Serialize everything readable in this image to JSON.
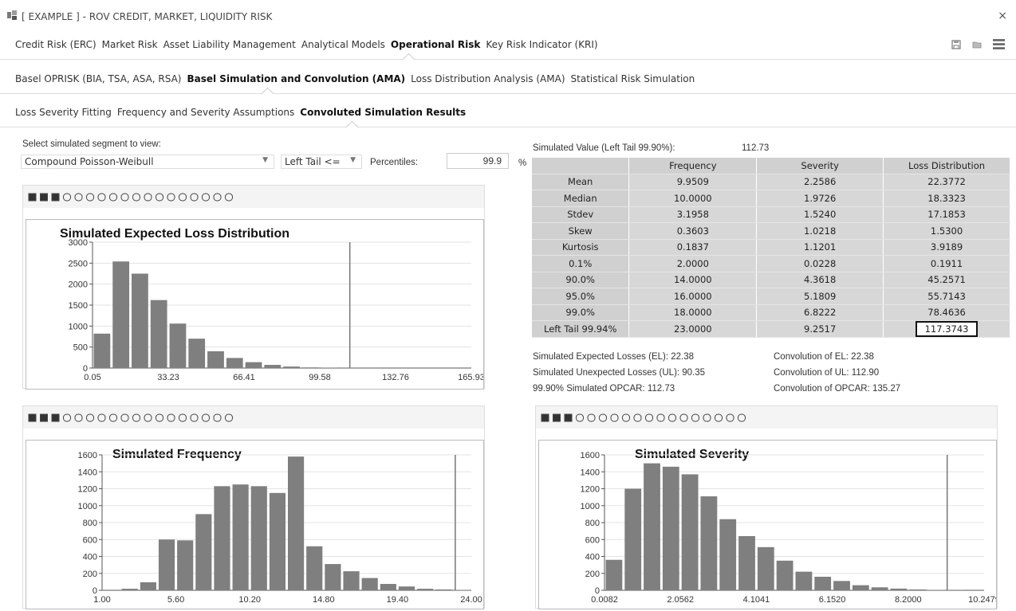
{
  "window": {
    "title": "[ EXAMPLE ] - ROV CREDIT, MARKET, LIQUIDITY RISK",
    "close": "×"
  },
  "main_tabs": [
    {
      "label": "Credit Risk (ERC)",
      "active": false
    },
    {
      "label": "Market Risk",
      "active": false
    },
    {
      "label": "Asset Liability Management",
      "active": false
    },
    {
      "label": "Analytical Models",
      "active": false
    },
    {
      "label": "Operational Risk",
      "active": true
    },
    {
      "label": "Key Risk Indicator (KRI)",
      "active": false
    }
  ],
  "sub_tabs": [
    {
      "label": "Basel OPRISK (BIA, TSA, ASA, RSA)",
      "active": false
    },
    {
      "label": "Basel Simulation and Convolution (AMA)",
      "active": true
    },
    {
      "label": "Loss Distribution Analysis (AMA)",
      "active": false
    },
    {
      "label": "Statistical Risk Simulation",
      "active": false
    }
  ],
  "sub_sub_tabs": [
    {
      "label": "Loss Severity Fitting",
      "active": false
    },
    {
      "label": "Frequency and Severity Assumptions",
      "active": false
    },
    {
      "label": "Convoluted Simulation Results",
      "active": true
    }
  ],
  "controls": {
    "segment_label": "Select simulated segment to view:",
    "segment_value": "Compound Poisson-Weibull",
    "tail_value": "Left Tail <=",
    "percentiles_label": "Percentiles:",
    "percentiles_value": "99.9",
    "percent_sign": "%"
  },
  "results": {
    "sim_value_label": "Simulated Value (Left Tail 99.90%):",
    "sim_value": "112.73",
    "columns": [
      "",
      "Frequency",
      "Severity",
      "Loss Distribution"
    ],
    "rows": [
      {
        "label": "Mean",
        "freq": "9.9509",
        "sev": "2.2586",
        "loss": "22.3772"
      },
      {
        "label": "Median",
        "freq": "10.0000",
        "sev": "1.9726",
        "loss": "18.3323"
      },
      {
        "label": "Stdev",
        "freq": "3.1958",
        "sev": "1.5240",
        "loss": "17.1853"
      },
      {
        "label": "Skew",
        "freq": "0.3603",
        "sev": "1.0218",
        "loss": "1.5300"
      },
      {
        "label": "Kurtosis",
        "freq": "0.1837",
        "sev": "1.1201",
        "loss": "3.9189"
      },
      {
        "label": "0.1%",
        "freq": "2.0000",
        "sev": "0.0228",
        "loss": "0.1911"
      },
      {
        "label": "90.0%",
        "freq": "14.0000",
        "sev": "4.3618",
        "loss": "45.2571"
      },
      {
        "label": "95.0%",
        "freq": "16.0000",
        "sev": "5.1809",
        "loss": "55.7143"
      },
      {
        "label": "99.0%",
        "freq": "18.0000",
        "sev": "6.8222",
        "loss": "78.4636"
      },
      {
        "label": "Left Tail 99.94%",
        "freq": "23.0000",
        "sev": "9.2517",
        "loss": "117.3743"
      }
    ],
    "summary_left": [
      "Simulated Expected Losses (EL): 22.38",
      "Simulated Unexpected Losses (UL): 90.35",
      "99.90% Simulated OPCAR: 112.73"
    ],
    "summary_right": [
      "Convolution of EL: 22.38",
      "Convolution of UL: 112.90",
      "Convolution of OPCAR: 135.27"
    ]
  },
  "chart_data": [
    {
      "type": "bar",
      "title": "Simulated Expected Loss Distribution",
      "ylim": [
        0,
        3000
      ],
      "yticks": [
        0,
        500,
        1000,
        1500,
        2000,
        2500,
        3000
      ],
      "xlim": [
        0.05,
        165.93
      ],
      "xticks": [
        "0.05",
        "33.23",
        "66.41",
        "99.58",
        "132.76",
        "165.93"
      ],
      "bin_width": 8.3,
      "values": [
        820,
        2540,
        2250,
        1620,
        1060,
        700,
        400,
        240,
        140,
        75,
        35,
        15,
        6,
        3,
        1
      ],
      "marker_x": 112.73,
      "grid": true
    },
    {
      "type": "bar",
      "title": "Simulated Frequency",
      "ylim": [
        0,
        1600
      ],
      "yticks": [
        0,
        200,
        400,
        600,
        800,
        1000,
        1200,
        1400,
        1600
      ],
      "xlim": [
        1.0,
        24.0
      ],
      "xticks": [
        "1.00",
        "5.60",
        "10.20",
        "14.80",
        "19.40",
        "24.00"
      ],
      "bin_width": 1.15,
      "values": [
        0,
        18,
        95,
        600,
        590,
        900,
        1230,
        1250,
        1230,
        1150,
        1580,
        520,
        310,
        225,
        145,
        75,
        45,
        18,
        10,
        4
      ],
      "marker_x": 23.0,
      "grid": true
    },
    {
      "type": "bar",
      "title": "Simulated Severity",
      "ylim": [
        0,
        1600
      ],
      "yticks": [
        0,
        200,
        400,
        600,
        800,
        1000,
        1200,
        1400,
        1600
      ],
      "xlim": [
        0.0082,
        10.2479
      ],
      "xticks": [
        "0.0082",
        "2.0562",
        "4.1041",
        "6.1520",
        "8.2000",
        "10.2479"
      ],
      "bin_width": 0.512,
      "values": [
        360,
        1200,
        1500,
        1460,
        1370,
        1110,
        840,
        640,
        510,
        350,
        220,
        160,
        110,
        60,
        35,
        20,
        10,
        5,
        2
      ],
      "marker_x": 9.2517,
      "grid": true
    }
  ]
}
